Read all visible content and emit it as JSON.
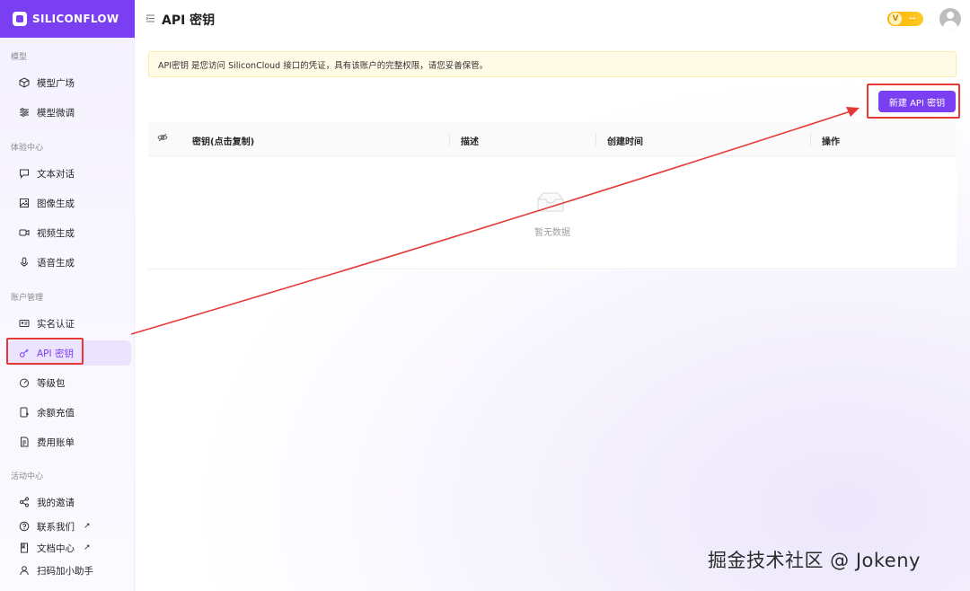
{
  "brand": {
    "name": "SILICONFLOW"
  },
  "sidebar": {
    "sections": [
      {
        "title": "模型",
        "items": [
          {
            "label": "模型广场",
            "icon": "cube-icon"
          },
          {
            "label": "模型微调",
            "icon": "sliders-icon"
          }
        ]
      },
      {
        "title": "体验中心",
        "items": [
          {
            "label": "文本对话",
            "icon": "chat-icon"
          },
          {
            "label": "图像生成",
            "icon": "image-icon"
          },
          {
            "label": "视频生成",
            "icon": "video-icon"
          },
          {
            "label": "语音生成",
            "icon": "mic-icon"
          }
        ]
      },
      {
        "title": "账户管理",
        "items": [
          {
            "label": "实名认证",
            "icon": "id-card-icon"
          },
          {
            "label": "API 密钥",
            "icon": "key-icon",
            "active": true
          },
          {
            "label": "等级包",
            "icon": "gauge-icon"
          },
          {
            "label": "余额充值",
            "icon": "wallet-icon"
          },
          {
            "label": "费用账单",
            "icon": "bill-icon"
          }
        ]
      },
      {
        "title": "活动中心",
        "items": [
          {
            "label": "我的邀请",
            "icon": "share-icon"
          },
          {
            "label": "联系我们",
            "icon": "help-icon",
            "external": "↗"
          },
          {
            "label": "文档中心",
            "icon": "doc-icon",
            "external": "↗"
          },
          {
            "label": "扫码加小助手",
            "icon": "user-icon"
          }
        ]
      }
    ]
  },
  "header": {
    "title": "API 密钥",
    "vip_letter": "V",
    "vip_value": "--"
  },
  "notice": {
    "text": "API密钥 是您访问 SiliconCloud 接口的凭证，具有该账户的完整权限，请您妥善保管。"
  },
  "actions": {
    "new_key_label": "新建 API 密钥"
  },
  "table": {
    "columns": [
      "密钥(点击复制)",
      "描述",
      "创建时间",
      "操作"
    ],
    "empty_text": "暂无数据"
  },
  "watermark": "掘金技术社区 @ Jokeny",
  "colors": {
    "accent": "#7b3ff2",
    "annotation": "#e53935",
    "notice_bg": "#fffbe6"
  }
}
